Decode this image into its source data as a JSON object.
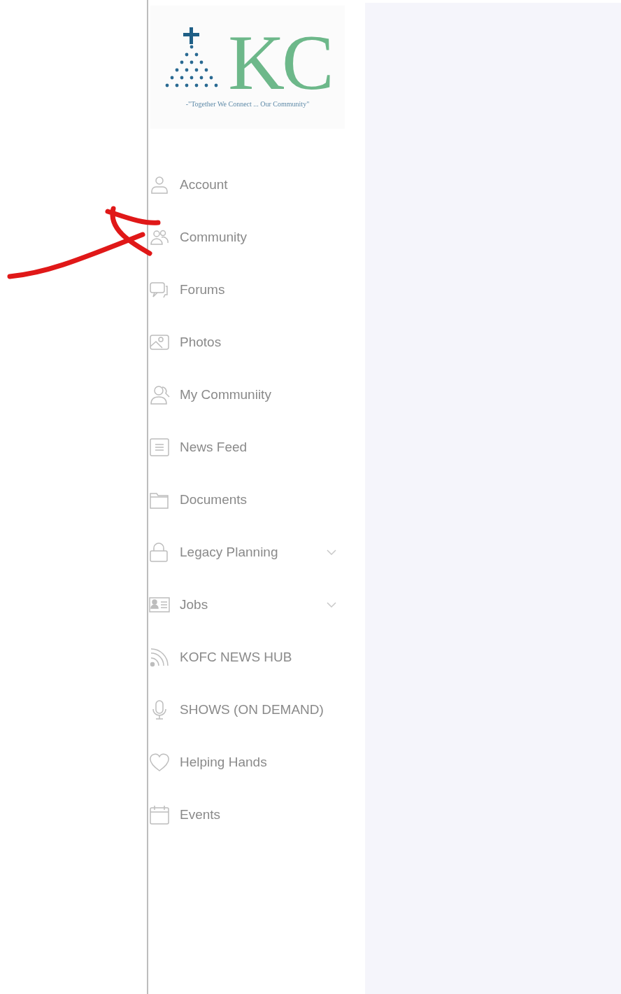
{
  "logo": {
    "mark": "KC",
    "tagline": "-\"Together We Connect ... Our Community\""
  },
  "sidebar": {
    "items": [
      {
        "label": "Account",
        "kind": "person",
        "expandable": false
      },
      {
        "label": "Community",
        "kind": "group",
        "expandable": false
      },
      {
        "label": "Forums",
        "kind": "chat",
        "expandable": false
      },
      {
        "label": "Photos",
        "kind": "photo",
        "expandable": false
      },
      {
        "label": "My Communiity",
        "kind": "people",
        "expandable": false
      },
      {
        "label": "News Feed",
        "kind": "list",
        "expandable": false
      },
      {
        "label": "Documents",
        "kind": "folder",
        "expandable": false
      },
      {
        "label": "Legacy Planning",
        "kind": "lock",
        "expandable": true
      },
      {
        "label": "Jobs",
        "kind": "card",
        "expandable": true
      },
      {
        "label": "KOFC NEWS HUB",
        "kind": "rss",
        "expandable": false
      },
      {
        "label": "SHOWS (ON DEMAND)",
        "kind": "mic",
        "expandable": false
      },
      {
        "label": "Helping Hands",
        "kind": "heart",
        "expandable": false
      },
      {
        "label": "Events",
        "kind": "calendar",
        "expandable": false
      }
    ]
  }
}
